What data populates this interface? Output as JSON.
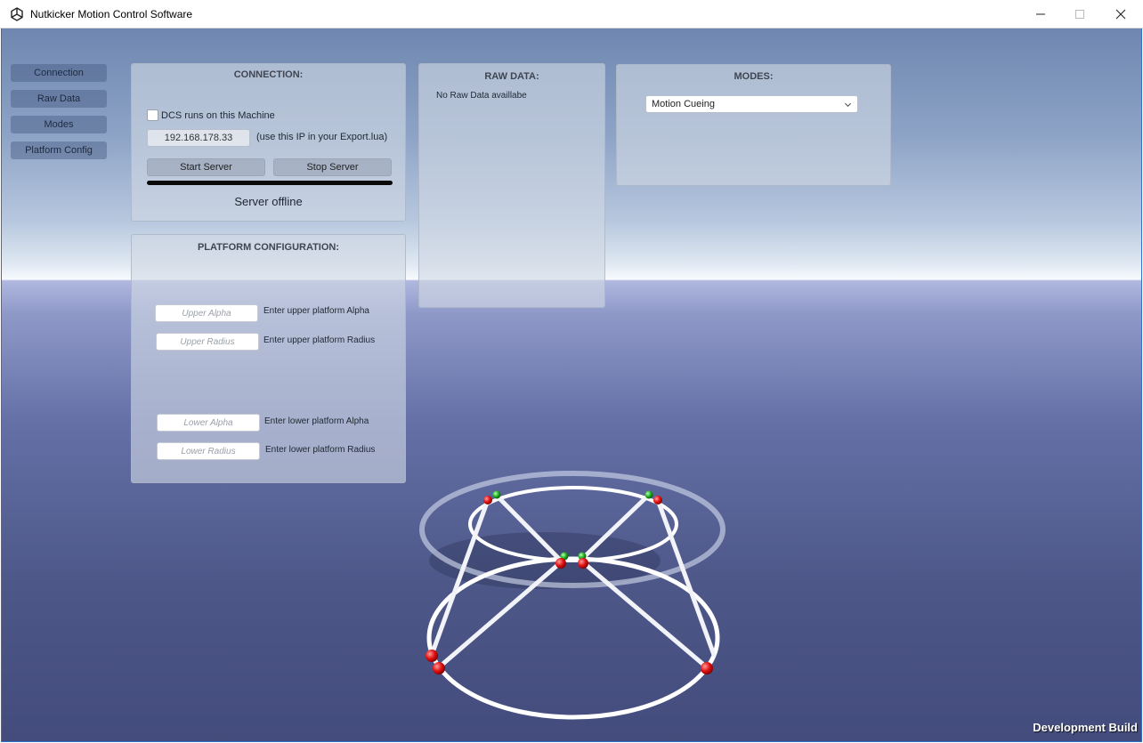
{
  "window": {
    "title": "Nutkicker Motion Control Software",
    "app_icon": "unity-logo-icon",
    "controls": [
      "minimize-icon",
      "maximize-icon",
      "close-icon"
    ]
  },
  "sidebar": {
    "items": [
      {
        "label": "Connection"
      },
      {
        "label": "Raw Data"
      },
      {
        "label": "Modes"
      },
      {
        "label": "Platform Config"
      }
    ]
  },
  "connection": {
    "title": "CONNECTION:",
    "dcs_checkbox_label": "DCS runs on this Machine",
    "dcs_checked": false,
    "ip_value": "192.168.178.33",
    "ip_hint": "(use this IP in your Export.lua)",
    "start_label": "Start Server",
    "stop_label": "Stop Server",
    "status": "Server offline"
  },
  "raw_data": {
    "title": "RAW DATA:",
    "text": "No Raw Data availlabe"
  },
  "modes": {
    "title": "MODES:",
    "selected": "Motion Cueing"
  },
  "platform_config": {
    "title": "PLATFORM CONFIGURATION:",
    "upper_alpha": {
      "placeholder": "Upper Alpha",
      "label": "Enter upper platform Alpha"
    },
    "upper_radius": {
      "placeholder": "Upper Radius",
      "label": "Enter upper platform Radius"
    },
    "lower_alpha": {
      "placeholder": "Lower Alpha",
      "label": "Enter lower platform Alpha"
    },
    "lower_radius": {
      "placeholder": "Lower Radius",
      "label": "Enter lower platform Radius"
    }
  },
  "footer": {
    "dev_build": "Development Build"
  },
  "colors": {
    "joint_red": "#e01010",
    "joint_green": "#20b020",
    "rod_white": "#ffffff"
  }
}
